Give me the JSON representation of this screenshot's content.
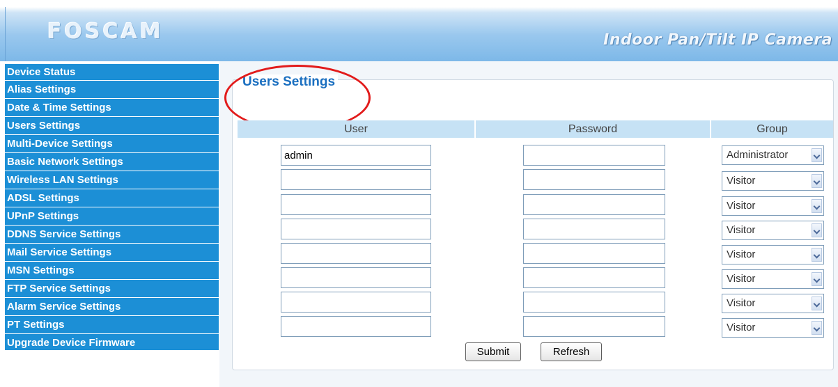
{
  "header": {
    "logo": "FOSCAM",
    "subtitle": "Indoor Pan/Tilt IP Camera"
  },
  "sidebar": {
    "items": [
      {
        "label": "Device Status"
      },
      {
        "label": "Alias Settings"
      },
      {
        "label": "Date & Time Settings"
      },
      {
        "label": "Users Settings"
      },
      {
        "label": "Multi-Device Settings"
      },
      {
        "label": "Basic Network Settings"
      },
      {
        "label": "Wireless LAN Settings"
      },
      {
        "label": "ADSL Settings"
      },
      {
        "label": "UPnP Settings"
      },
      {
        "label": "DDNS Service Settings"
      },
      {
        "label": "Mail Service Settings"
      },
      {
        "label": "MSN Settings"
      },
      {
        "label": "FTP Service Settings"
      },
      {
        "label": "Alarm Service Settings"
      },
      {
        "label": "PT Settings"
      },
      {
        "label": "Upgrade Device Firmware"
      }
    ]
  },
  "main": {
    "section_title": "Users Settings",
    "columns": {
      "user": "User",
      "password": "Password",
      "group": "Group"
    },
    "rows": [
      {
        "user": "admin",
        "password": "",
        "group": "Administrator"
      },
      {
        "user": "",
        "password": "",
        "group": "Visitor"
      },
      {
        "user": "",
        "password": "",
        "group": "Visitor"
      },
      {
        "user": "",
        "password": "",
        "group": "Visitor"
      },
      {
        "user": "",
        "password": "",
        "group": "Visitor"
      },
      {
        "user": "",
        "password": "",
        "group": "Visitor"
      },
      {
        "user": "",
        "password": "",
        "group": "Visitor"
      },
      {
        "user": "",
        "password": "",
        "group": "Visitor"
      }
    ],
    "buttons": {
      "submit": "Submit",
      "refresh": "Refresh"
    }
  },
  "colors": {
    "nav_background": "#1c8fd6",
    "title_blue": "#1a6fc0",
    "table_header": "#c6e2f5",
    "highlight_oval": "#e21b1b"
  }
}
